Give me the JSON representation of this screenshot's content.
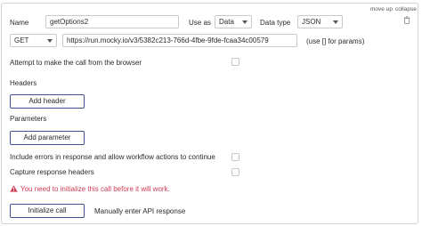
{
  "toolbar": {
    "move_up": "move up",
    "collapse": "collapse"
  },
  "call": {
    "name_label": "Name",
    "name_value": "getOptions2",
    "use_as_label": "Use as",
    "use_as_value": "Data",
    "data_type_label": "Data type",
    "data_type_value": "JSON",
    "method_value": "GET",
    "url_value": "https://run.mocky.io/v3/5382c213-766d-4fbe-9fde-fcaa34c00579",
    "params_hint": "(use [] for params)"
  },
  "options": {
    "browser_call_label": "Attempt to make the call from the browser",
    "include_errors_label": "Include errors in response and allow workflow actions to continue",
    "capture_headers_label": "Capture response headers"
  },
  "headers": {
    "title": "Headers",
    "add_button": "Add header"
  },
  "parameters": {
    "title": "Parameters",
    "add_button": "Add parameter"
  },
  "warning": {
    "text": "You need to initialize this call before it will work.",
    "color": "#d23b56"
  },
  "actions": {
    "initialize_button": "Initialize call",
    "manual_response": "Manually enter API response",
    "accent": "#3f4f8f"
  }
}
